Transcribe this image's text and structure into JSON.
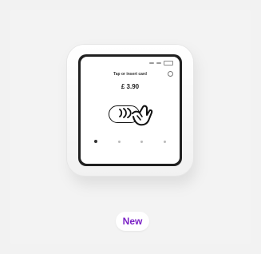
{
  "device": {
    "screen": {
      "title": "Tap or insert card",
      "amount": "£ 3.90",
      "menu_icon": "settings-icon",
      "payment_icon": "contactless-icon",
      "hand_icon": "hand-tap-icon",
      "page_indicator_count": 4,
      "active_page_index": 0
    }
  },
  "badge": {
    "label": "New",
    "color": "#7b22c6"
  }
}
